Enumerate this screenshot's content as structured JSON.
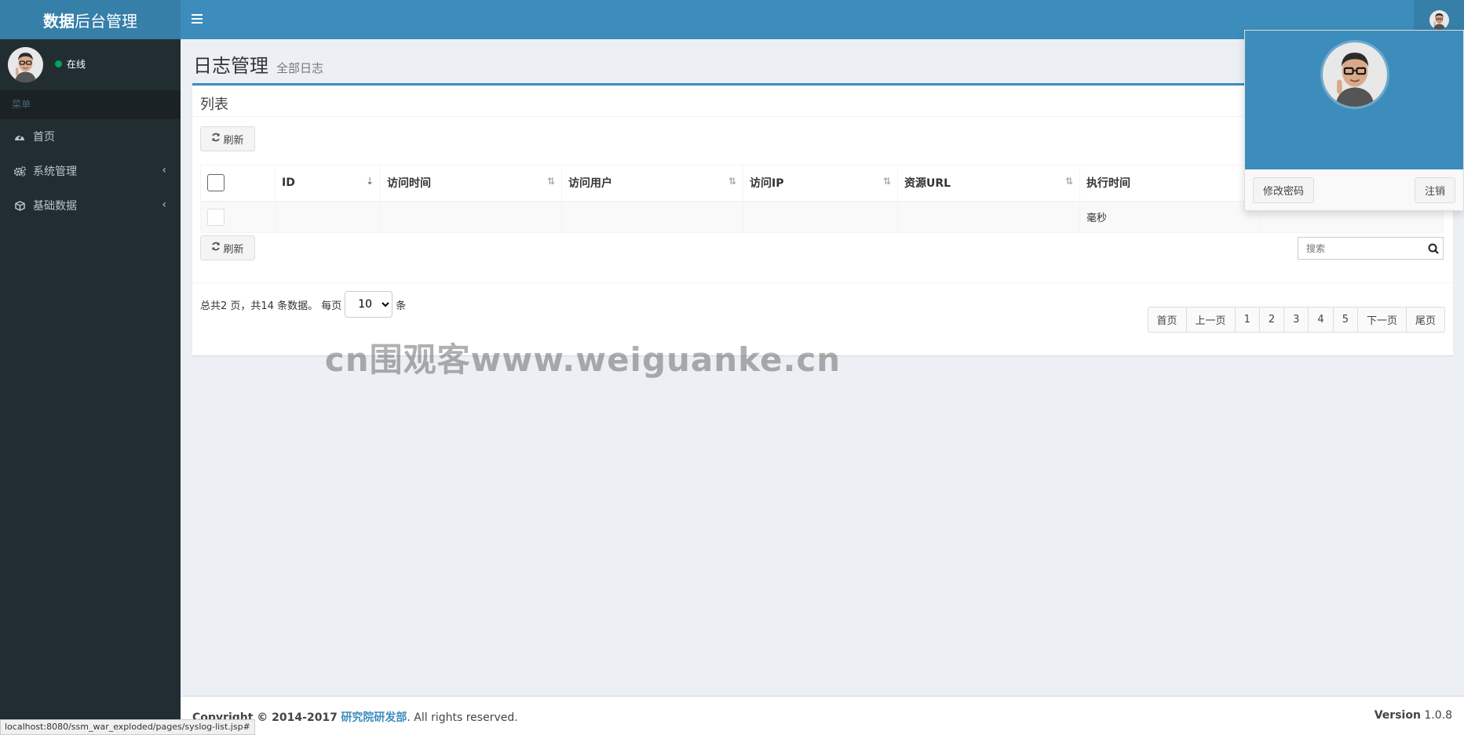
{
  "header": {
    "logo_bold": "数据",
    "logo_rest": "后台管理"
  },
  "sidebar": {
    "status": "在线",
    "menu_header": "菜单",
    "items": [
      {
        "label": "首页",
        "icon": "dashboard-icon"
      },
      {
        "label": "系统管理",
        "icon": "cogs-icon"
      },
      {
        "label": "基础数据",
        "icon": "cube-icon"
      }
    ]
  },
  "page": {
    "title": "日志管理",
    "subtitle": "全部日志"
  },
  "box": {
    "title": "列表",
    "refresh_label": "刷新",
    "columns": [
      "ID",
      "访问时间",
      "访问用户",
      "访问IP",
      "资源URL",
      "执行时间"
    ],
    "row": {
      "exec_time": "毫秒"
    },
    "search_placeholder": "搜索"
  },
  "pagination_info": {
    "prefix": "总共2 页，共14 条数据。 每页",
    "page_size": "10",
    "suffix": "条"
  },
  "pagination": [
    "首页",
    "上一页",
    "1",
    "2",
    "3",
    "4",
    "5",
    "下一页",
    "尾页"
  ],
  "watermark": "cn围观客www.weiguanke.cn",
  "footer": {
    "copyright_prefix": "Copyright © 2014-2017",
    "company": "研究院研发部",
    "rights": ". All rights reserved.",
    "version_label": "Version",
    "version": "1.0.8"
  },
  "status_url": "localhost:8080/ssm_war_exploded/pages/syslog-list.jsp#",
  "dropdown": {
    "change_password": "修改密码",
    "logout": "注销"
  },
  "colors": {
    "header": "#3c8dbc",
    "logo": "#367fa9",
    "sidebar": "#222d32"
  }
}
